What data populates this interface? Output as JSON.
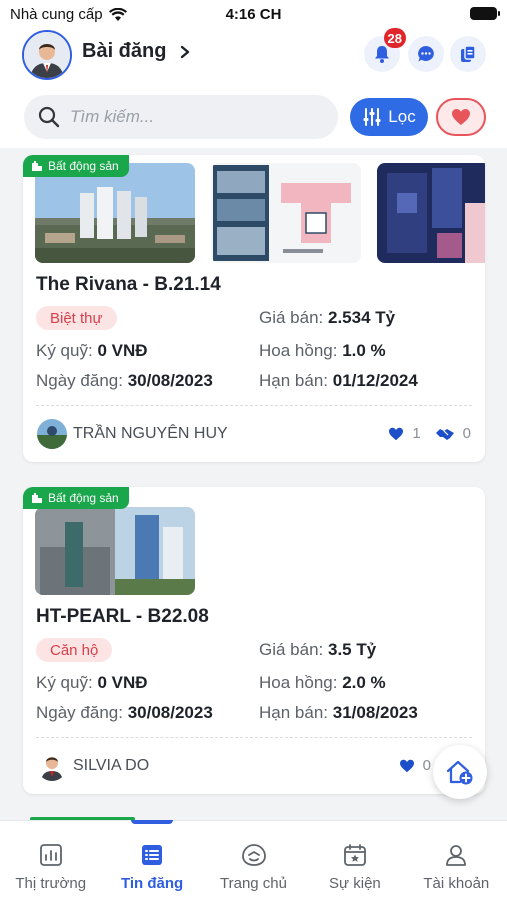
{
  "status_bar": {
    "carrier": "Nhà cung cấp",
    "time": "4:16 CH"
  },
  "header": {
    "title": "Bài đăng",
    "notification_count": "28",
    "search_placeholder": "Tìm kiếm...",
    "filter_label": "Lọc"
  },
  "posts": [
    {
      "category": "Bất động sản",
      "title": "The Rivana - B.21.14",
      "type": "Biệt thự",
      "price_label": "Giá bán:",
      "price": "2.534 Tỷ",
      "deposit_label": "Ký quỹ:",
      "deposit": "0 VNĐ",
      "commission_label": "Hoa hồng:",
      "commission": "1.0 %",
      "posted_label": "Ngày đăng:",
      "posted": "30/08/2023",
      "deadline_label": "Hạn bán:",
      "deadline": "01/12/2024",
      "owner": "TRẦN NGUYÊN HUY",
      "likes": "1",
      "shares": "0"
    },
    {
      "category": "Bất động sản",
      "title": "HT-PEARL - B22.08",
      "type": "Căn hộ",
      "price_label": "Giá bán:",
      "price": "3.5 Tỷ",
      "deposit_label": "Ký quỹ:",
      "deposit": "0 VNĐ",
      "commission_label": "Hoa hồng:",
      "commission": "2.0 %",
      "posted_label": "Ngày đăng:",
      "posted": "30/08/2023",
      "deadline_label": "Hạn bán:",
      "deadline": "31/08/2023",
      "owner": "SILVIA DO",
      "likes": "0"
    }
  ],
  "bottom_nav": [
    {
      "label": "Thị trường",
      "icon": "chart-icon"
    },
    {
      "label": "Tin đăng",
      "icon": "list-icon",
      "active": true
    },
    {
      "label": "Trang chủ",
      "icon": "home-smile-icon"
    },
    {
      "label": "Sự kiện",
      "icon": "calendar-icon"
    },
    {
      "label": "Tài khoản",
      "icon": "person-icon"
    }
  ],
  "colors": {
    "primary": "#2f5ee0",
    "green": "#1aa64b",
    "badge_red": "#e0262a"
  }
}
